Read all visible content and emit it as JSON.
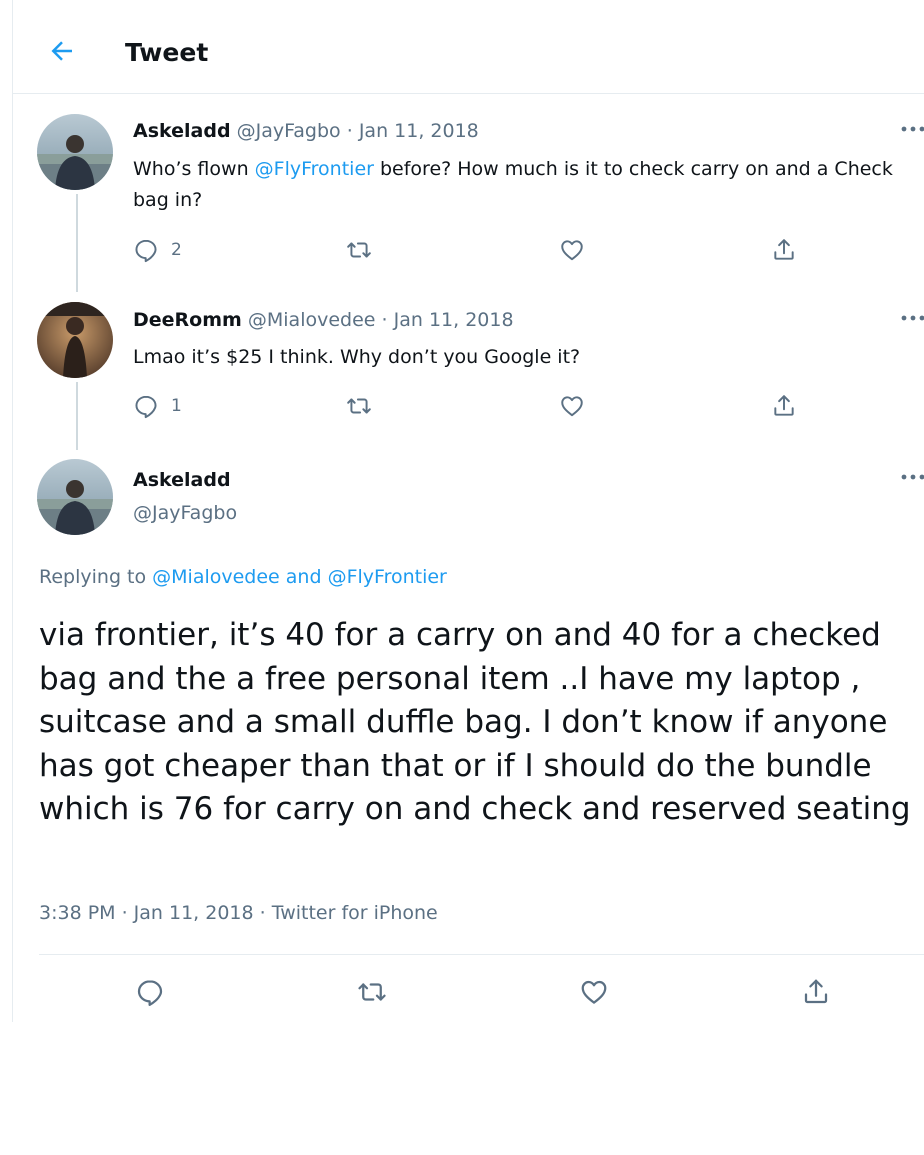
{
  "header": {
    "title": "Tweet"
  },
  "thread": [
    {
      "name": "Askeladd",
      "handle": "@JayFagbo",
      "separator": "·",
      "date": "Jan 11, 2018",
      "text_before": "Who’s flown ",
      "mention": "@FlyFrontier",
      "text_after": " before? How much is it to check carry on and a Check bag in?",
      "reply_count": "2"
    },
    {
      "name": "DeeRomm",
      "handle": "@Mialovedee",
      "separator": "·",
      "date": "Jan 11, 2018",
      "text": "Lmao it’s $25 I think. Why don’t you Google it?",
      "reply_count": "1"
    }
  ],
  "main_tweet": {
    "name": "Askeladd",
    "handle": "@JayFagbo",
    "replying_prefix": "Replying to ",
    "replying_mention_1": "@Mialovedee",
    "replying_and": " and ",
    "replying_mention_2": "@FlyFrontier",
    "text": "via frontier, it’s 40 for a carry on and 40 for a checked bag and the a free personal item ..I have my laptop , suitcase and a small duffle bag. I don’t know if anyone has got cheaper than that or if I should do the bundle which is 76 for carry on and check  and reserved seating",
    "timestamp": "3:38 PM · Jan 11, 2018 · Twitter for iPhone"
  },
  "icons": {
    "back": "arrow-left-icon",
    "reply": "speech-bubble-icon",
    "retweet": "retweet-arrows-icon",
    "like": "heart-icon",
    "share": "share-upload-icon",
    "more": "more-dots-icon"
  },
  "colors": {
    "accent": "#1d9bf0",
    "secondary_text": "#5b7083",
    "border": "#e6ecf0"
  }
}
